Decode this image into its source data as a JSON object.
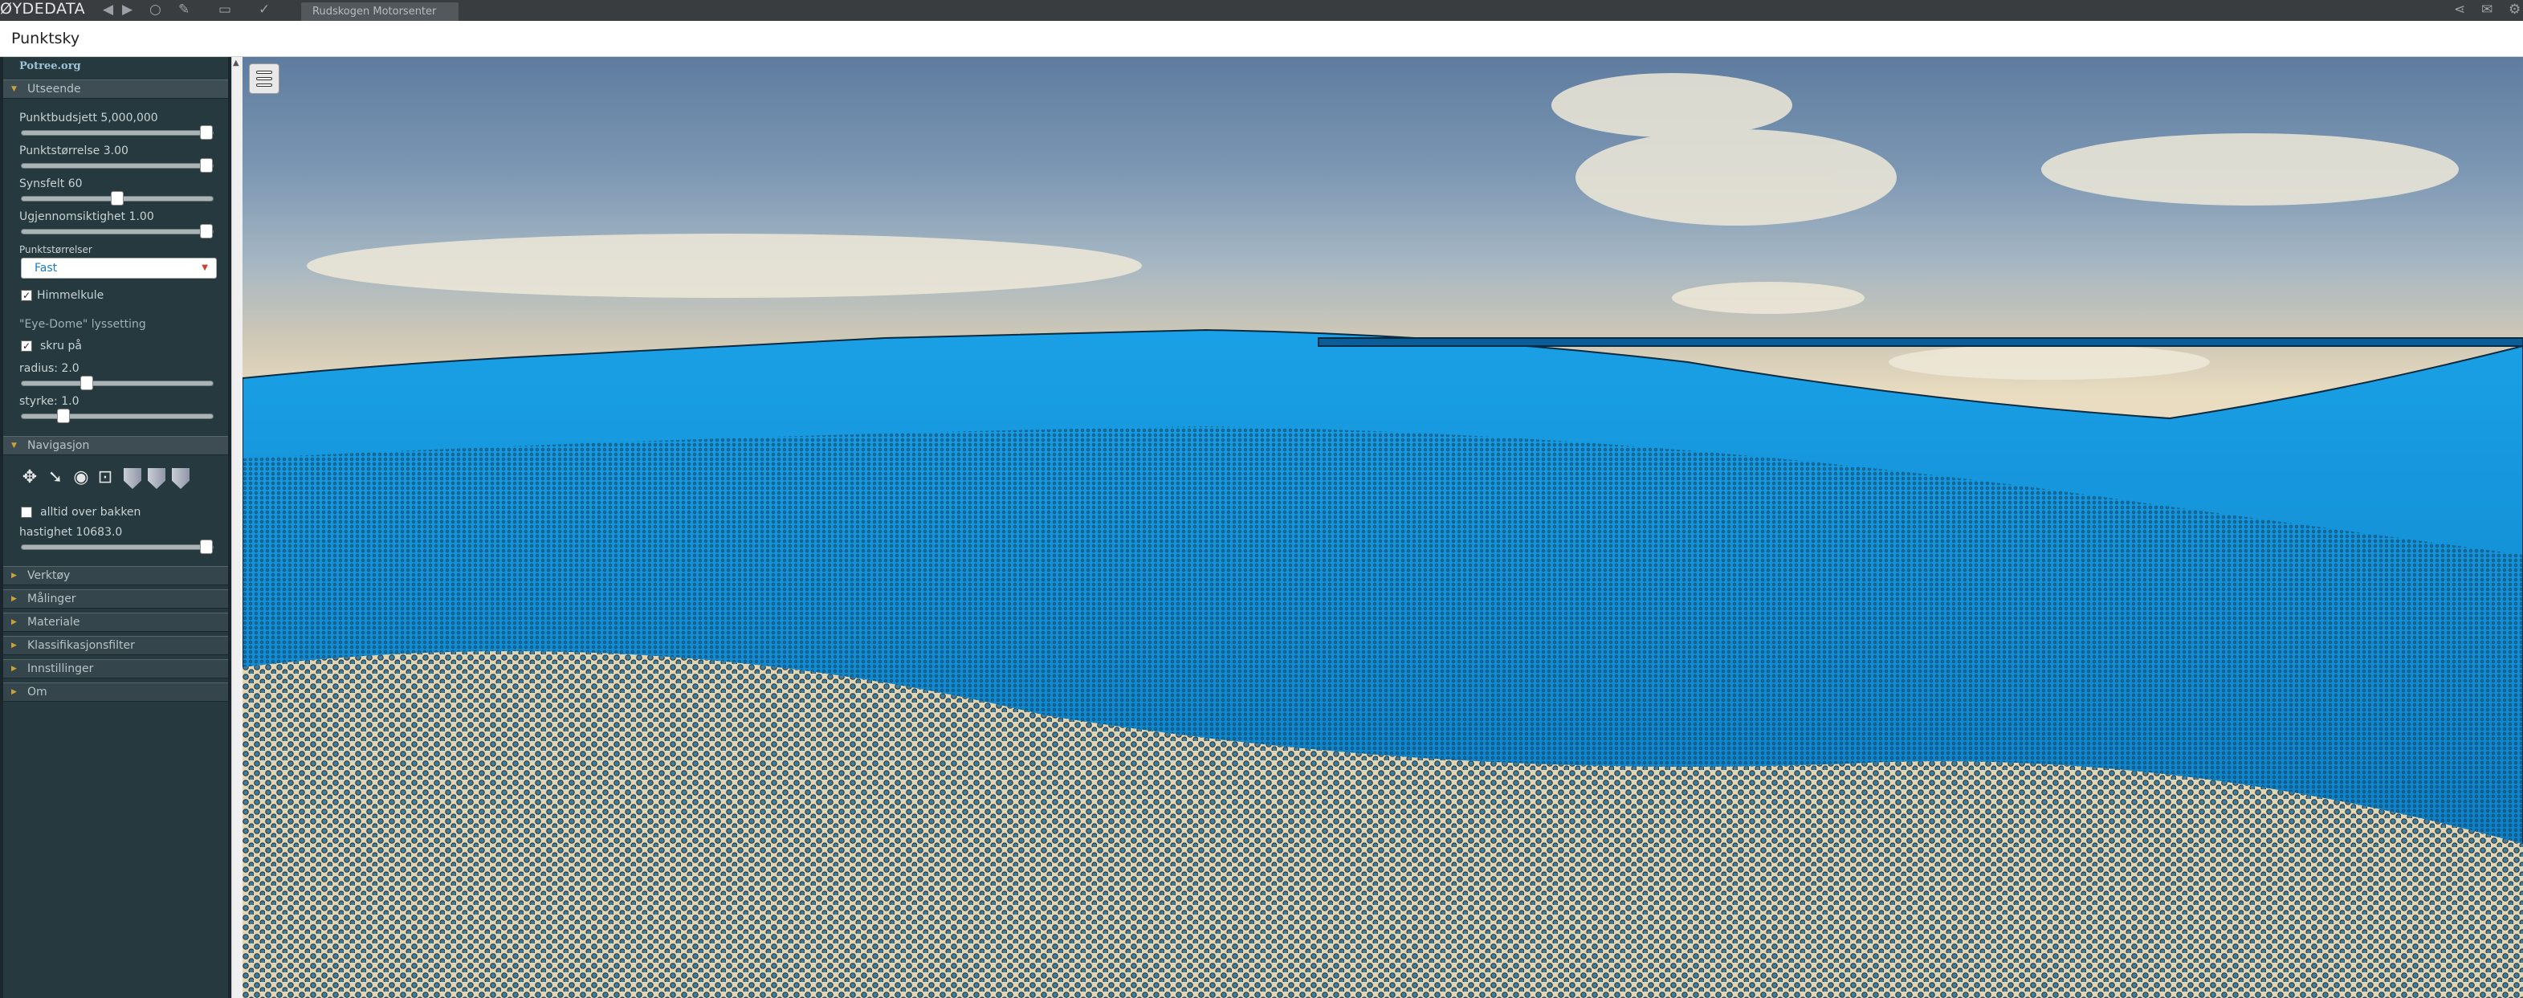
{
  "app": {
    "brand": "ØYDEDATA",
    "tab_label": "Rudskogen Motorsenter",
    "dialog_title": "Punktsky"
  },
  "sidebar": {
    "potree_link": "Potree.org",
    "sections": {
      "appearance": "Utseende",
      "navigation": "Navigasjon",
      "tools": "Verktøy",
      "measurements": "Målinger",
      "material": "Materiale",
      "classification": "Klassifikasjonsfilter",
      "settings": "Innstillinger",
      "about": "Om"
    },
    "appearance": {
      "point_budget_label": "Punktbudsjett 5,000,000",
      "point_budget_level": 1.0,
      "point_size_label": "Punktstørrelse 3.00",
      "point_size_level": 1.0,
      "fov_label": "Synsfelt 60",
      "fov_level": 0.5,
      "opacity_label": "Ugjennomsiktighet 1.00",
      "opacity_level": 1.0,
      "sizing_label": "Punktstørrelser",
      "sizing_value": "Fast",
      "skybox_label": "Himmelkule",
      "skybox_checked": true,
      "edl_heading": "\"Eye-Dome\" lyssetting",
      "edl_enable_label": "skru på",
      "edl_enabled": true,
      "radius_label": "radius: 2.0",
      "radius_level": 0.33,
      "strength_label": "styrke: 1.0",
      "strength_level": 0.2
    },
    "navigation": {
      "always_above_label": "alltid over bakken",
      "always_above_checked": false,
      "speed_label": "hastighet 10683.0",
      "speed_level": 1.0
    }
  },
  "colors": {
    "point_cloud": "#0a8ad0",
    "sky_top": "#5e7ca0",
    "ground": "#e2d5b4"
  }
}
